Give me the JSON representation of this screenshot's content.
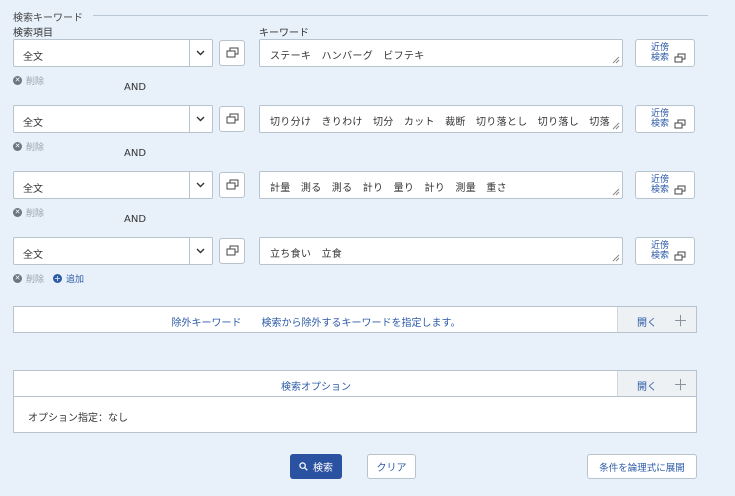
{
  "section": {
    "title": "検索キーワード"
  },
  "columns": {
    "item_label": "検索項目",
    "keyword_label": "キーワード"
  },
  "rows": [
    {
      "field": "全文",
      "keyword": "ステーキ　ハンバーグ　ビフテキ",
      "near_label": "近傍検索",
      "delete_label": "削除",
      "connector": "AND"
    },
    {
      "field": "全文",
      "keyword": "切り分け　きりわけ　切分　カット　裁断　切り落とし　切り落し　切落",
      "near_label": "近傍検索",
      "delete_label": "削除",
      "connector": "AND"
    },
    {
      "field": "全文",
      "keyword": "計量　測る　測る　計り　量り　計り　測量　重さ",
      "near_label": "近傍検索",
      "delete_label": "削除",
      "connector": "AND"
    },
    {
      "field": "全文",
      "keyword": "立ち食い　立食",
      "near_label": "近傍検索",
      "delete_label": "削除",
      "add_label": "追加"
    }
  ],
  "exclude_panel": {
    "title": "除外キーワード　　検索から除外するキーワードを指定します。",
    "open_label": "開く",
    "plus": "＋"
  },
  "options_panel": {
    "title": "検索オプション",
    "open_label": "開く",
    "plus": "＋",
    "body": "オプション指定：なし"
  },
  "actions": {
    "search_label": "検索",
    "clear_label": "クリア",
    "expand_label": "条件を論理式に展開"
  },
  "icons": {
    "delete": "x-circle-icon",
    "add": "plus-circle-icon",
    "window": "window-icon",
    "chevron": "chevron-down-icon",
    "search": "search-icon"
  },
  "colors": {
    "accent": "#2a52a0",
    "background": "#e8f1fa"
  }
}
